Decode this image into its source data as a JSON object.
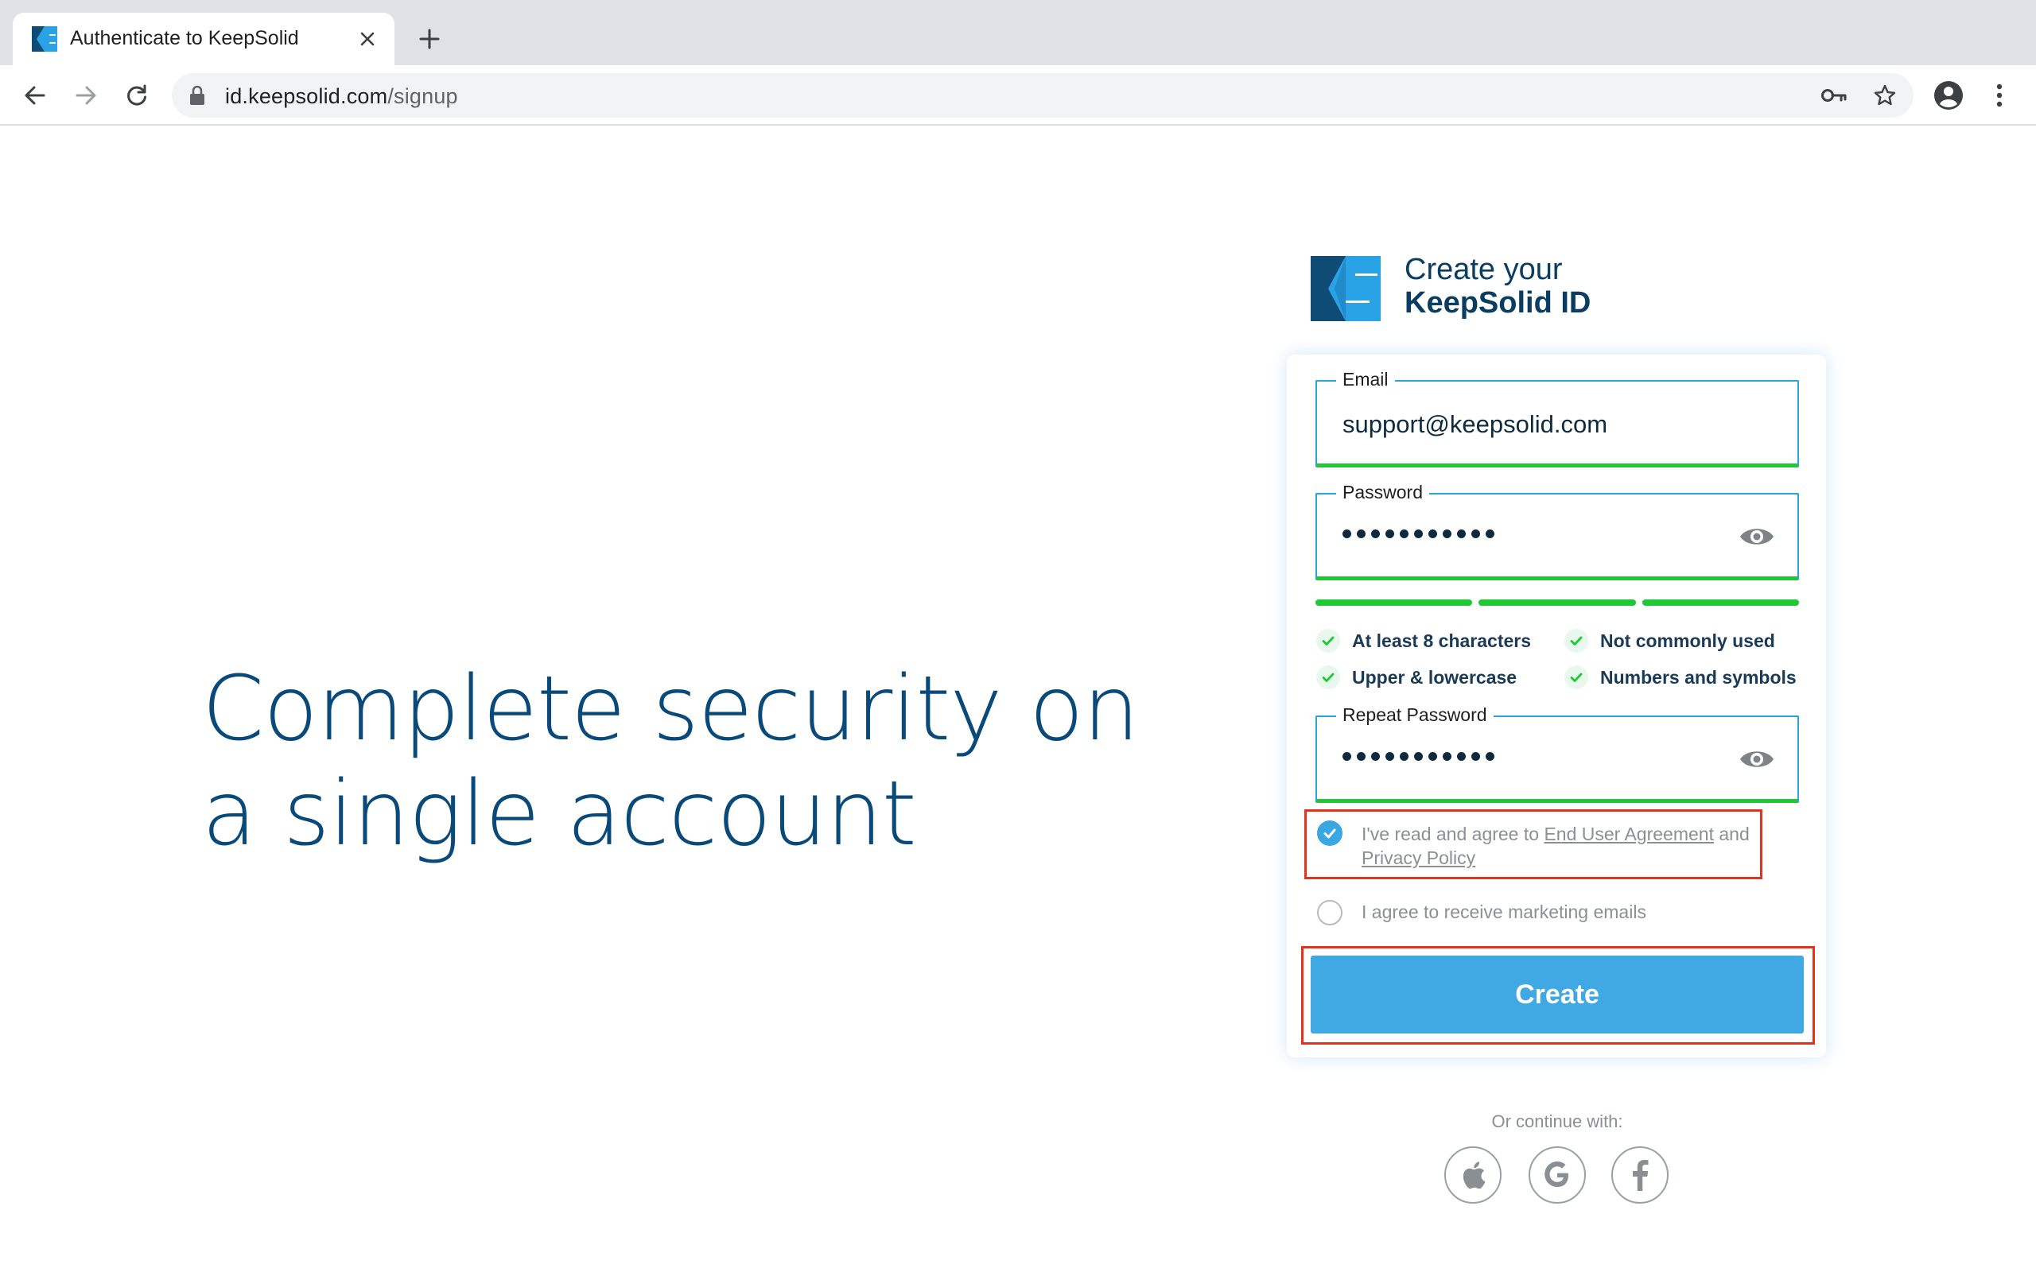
{
  "browser": {
    "tab_title": "Authenticate to KeepSolid",
    "url_host": "id.keepsolid.com",
    "url_path": "/signup"
  },
  "page": {
    "hero_line1": "Complete security on",
    "hero_line2": "a single account",
    "brand_line1": "Create your",
    "brand_line2": "KeepSolid ID",
    "email": {
      "label": "Email",
      "value": "support@keepsolid.com"
    },
    "password": {
      "label": "Password",
      "masked_length": 11
    },
    "password_strength_level": 3,
    "password_rules": [
      "At least 8 characters",
      "Not commonly used",
      "Upper & lowercase",
      "Numbers and symbols"
    ],
    "repeat_password": {
      "label": "Repeat Password",
      "masked_length": 11
    },
    "agreement": {
      "prefix": "I've read and agree to",
      "eula_link": "End User Agreement",
      "conjunction": "and",
      "privacy_link": "Privacy Policy",
      "checked": true
    },
    "marketing": {
      "label": "I agree to receive marketing emails",
      "checked": false
    },
    "create_button": "Create",
    "continue_with": "Or continue with:",
    "social_icons": [
      "apple-icon",
      "google-icon",
      "facebook-icon"
    ]
  },
  "colors": {
    "brand_dark": "#0a3d62",
    "hero_text": "#0a4a7a",
    "accent_blue": "#40a8e2",
    "valid_green": "#1ec935",
    "highlight_red": "#e3321e"
  }
}
